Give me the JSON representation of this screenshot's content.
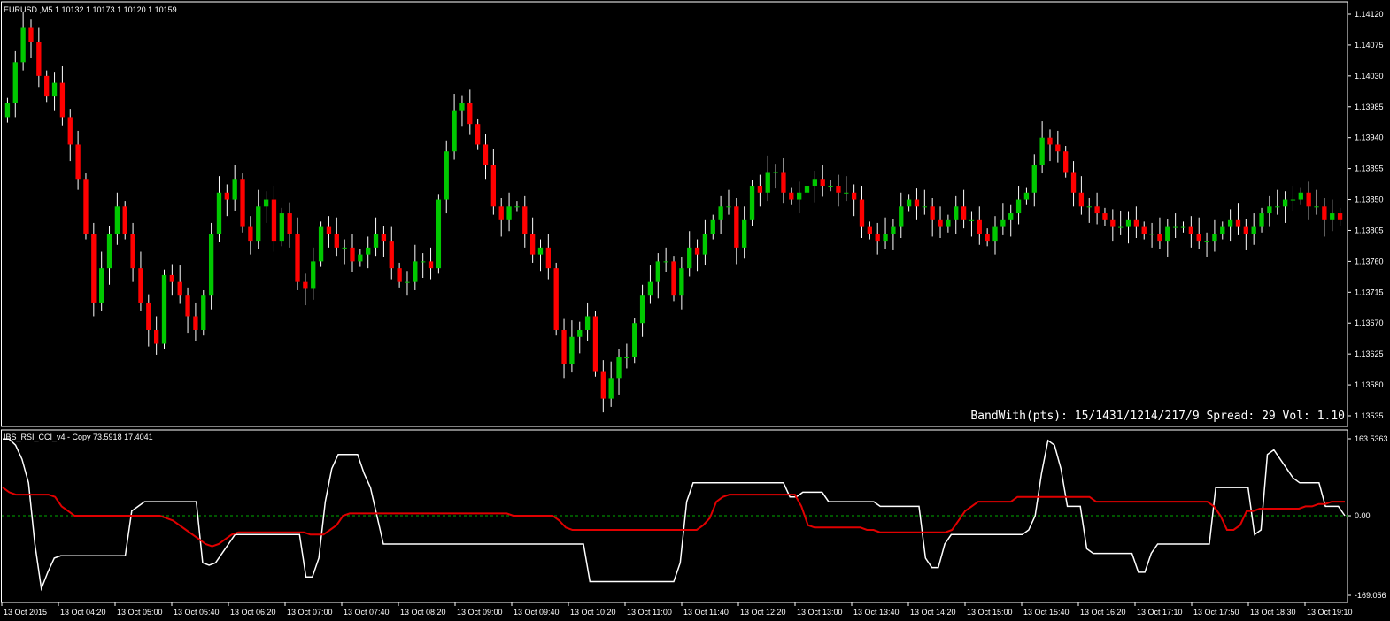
{
  "main_chart": {
    "header": "EURUSD.,M5  1.10132 1.10173 1.10120 1.10159",
    "status": "BandWith(pts): 15/1431/1214/217/9 Spread: 29 Vol: 1.10",
    "price_ticks": [
      "1.14120",
      "1.14075",
      "1.14030",
      "1.13985",
      "1.13940",
      "1.13895",
      "1.13850",
      "1.13805",
      "1.13760",
      "1.13715",
      "1.13670",
      "1.13625",
      "1.13580",
      "1.13535"
    ],
    "candle_colors": {
      "up": "#00c800",
      "down": "#ff0000",
      "wick": "#ffffff"
    }
  },
  "indicator": {
    "header": "IBS_RSI_CCI_v4 - Copy 73.5918 17.4041",
    "ticks": [
      "163.5363",
      "0.00",
      "-169.056"
    ],
    "line_colors": {
      "fast": "#ffffff",
      "slow": "#e00000",
      "zero": "#00aa00"
    }
  },
  "time_axis": [
    "13 Oct 2015",
    "13 Oct 04:20",
    "13 Oct 05:00",
    "13 Oct 05:40",
    "13 Oct 06:20",
    "13 Oct 07:00",
    "13 Oct 07:40",
    "13 Oct 08:20",
    "13 Oct 09:00",
    "13 Oct 09:40",
    "13 Oct 10:20",
    "13 Oct 11:00",
    "13 Oct 11:40",
    "13 Oct 12:20",
    "13 Oct 13:00",
    "13 Oct 13:40",
    "13 Oct 14:20",
    "13 Oct 15:00",
    "13 Oct 15:40",
    "13 Oct 16:20",
    "13 Oct 17:10",
    "13 Oct 17:50",
    "13 Oct 18:30",
    "13 Oct 19:10"
  ],
  "chart_data": [
    {
      "type": "candlestick",
      "title": "EURUSD.,M5",
      "ylim": [
        1.13535,
        1.1412
      ],
      "close": [
        1.1399,
        1.1405,
        1.141,
        1.1408,
        1.1403,
        1.14,
        1.1402,
        1.1397,
        1.1393,
        1.1388,
        1.138,
        1.137,
        1.1375,
        1.138,
        1.1384,
        1.138,
        1.1375,
        1.137,
        1.1366,
        1.1364,
        1.1374,
        1.1373,
        1.1371,
        1.1368,
        1.1366,
        1.1371,
        1.138,
        1.1386,
        1.1385,
        1.1388,
        1.1381,
        1.1379,
        1.1384,
        1.1385,
        1.1379,
        1.1383,
        1.138,
        1.1373,
        1.1372,
        1.1376,
        1.1381,
        1.138,
        1.1378,
        1.1378,
        1.1376,
        1.1377,
        1.1378,
        1.138,
        1.1379,
        1.1375,
        1.1373,
        1.1373,
        1.1376,
        1.1376,
        1.1375,
        1.1385,
        1.1392,
        1.1398,
        1.1399,
        1.1396,
        1.1393,
        1.139,
        1.1384,
        1.1382,
        1.1384,
        1.1384,
        1.138,
        1.1377,
        1.1378,
        1.1375,
        1.1366,
        1.1361,
        1.1365,
        1.1366,
        1.1368,
        1.136,
        1.1356,
        1.1359,
        1.1362,
        1.1362,
        1.1367,
        1.1371,
        1.1373,
        1.1376,
        1.1376,
        1.1371,
        1.1375,
        1.1378,
        1.1377,
        1.138,
        1.1382,
        1.1384,
        1.1384,
        1.1378,
        1.1382,
        1.1387,
        1.1386,
        1.1389,
        1.1389,
        1.1386,
        1.1385,
        1.1386,
        1.1387,
        1.1388,
        1.1387,
        1.1387,
        1.1386,
        1.1386,
        1.1385,
        1.1381,
        1.138,
        1.1379,
        1.138,
        1.1381,
        1.1384,
        1.1385,
        1.1384,
        1.1384,
        1.1382,
        1.1381,
        1.1382,
        1.1384,
        1.1382,
        1.1382,
        1.138,
        1.1379,
        1.1381,
        1.1382,
        1.1383,
        1.1385,
        1.1386,
        1.139,
        1.1394,
        1.1393,
        1.1392,
        1.1389,
        1.1386,
        1.1384,
        1.1384,
        1.1383,
        1.1382,
        1.1381,
        1.1381,
        1.1382,
        1.1381,
        1.138,
        1.138,
        1.1379,
        1.1381,
        1.1381,
        1.1381,
        1.138,
        1.1379,
        1.1379,
        1.138,
        1.1381,
        1.1382,
        1.1381,
        1.138,
        1.1381,
        1.1383,
        1.1384,
        1.1384,
        1.1385,
        1.1385,
        1.1386,
        1.1384,
        1.1384,
        1.1382,
        1.1383,
        1.1382
      ],
      "ohlc_note": "OHLC series drawn by script from close values"
    },
    {
      "type": "line",
      "title": "IBS_RSI_CCI_v4 - Copy",
      "ylim": [
        -169.056,
        163.5363
      ],
      "series": [
        {
          "name": "IBS_RSI_CCI_v4 - Copy 73.5918",
          "values": [
            163,
            163,
            150,
            120,
            70,
            -60,
            -155,
            -120,
            -90,
            -85,
            -85,
            -85,
            -85,
            -85,
            -85,
            -85,
            -85,
            -85,
            -85,
            -85,
            10,
            20,
            30,
            30,
            30,
            30,
            30,
            30,
            30,
            30,
            30,
            -100,
            -105,
            -100,
            -80,
            -60,
            -40,
            -40,
            -40,
            -40,
            -40,
            -40,
            -40,
            -40,
            -40,
            -40,
            -40,
            -130,
            -130,
            -90,
            30,
            100,
            130,
            130,
            130,
            130,
            90,
            60,
            0,
            -60,
            -60,
            -60,
            -60,
            -60,
            -60,
            -60,
            -60,
            -60,
            -60,
            -60,
            -60,
            -60,
            -60,
            -60,
            -60,
            -60,
            -60,
            -60,
            -60,
            -60,
            -60,
            -60,
            -60,
            -60,
            -60,
            -60,
            -60,
            -60,
            -60,
            -60,
            -60,
            -140,
            -140,
            -140,
            -140,
            -140,
            -140,
            -140,
            -140,
            -140,
            -140,
            -140,
            -140,
            -140,
            -140,
            -100,
            30,
            70,
            70,
            70,
            70,
            70,
            70,
            70,
            70,
            70,
            70,
            70,
            70,
            70,
            70,
            70,
            40,
            40,
            50,
            50,
            50,
            50,
            30,
            30,
            30,
            30,
            30,
            30,
            30,
            30,
            20,
            20,
            20,
            20,
            20,
            20,
            20,
            -90,
            -110,
            -110,
            -60,
            -40,
            -40,
            -40,
            -40,
            -40,
            -40,
            -40,
            -40,
            -40,
            -40,
            -40,
            -40,
            -30,
            0,
            90,
            160,
            150,
            100,
            20,
            20,
            20,
            -70,
            -80,
            -80,
            -80,
            -80,
            -80,
            -80,
            -80,
            -120,
            -120,
            -80,
            -60,
            -60,
            -60,
            -60,
            -60,
            -60,
            -60,
            -60,
            -60,
            60,
            60,
            60,
            60,
            60,
            60,
            -40,
            -30,
            130,
            140,
            120,
            100,
            80,
            70,
            70,
            70,
            70,
            20,
            20,
            20,
            0
          ]
        },
        {
          "name": "IBS_RSI_CCI_v4 - Copy 17.4041",
          "values": [
            60,
            50,
            45,
            45,
            45,
            45,
            45,
            45,
            40,
            20,
            10,
            0,
            0,
            0,
            0,
            0,
            0,
            0,
            0,
            0,
            0,
            0,
            0,
            0,
            0,
            -5,
            -10,
            -20,
            -30,
            -40,
            -50,
            -60,
            -65,
            -60,
            -50,
            -40,
            -35,
            -35,
            -35,
            -35,
            -35,
            -35,
            -35,
            -35,
            -35,
            -35,
            -35,
            -40,
            -40,
            -40,
            -30,
            -20,
            0,
            5,
            5,
            5,
            5,
            5,
            5,
            5,
            5,
            5,
            5,
            5,
            5,
            5,
            5,
            5,
            5,
            5,
            5,
            5,
            5,
            5,
            5,
            5,
            5,
            5,
            0,
            0,
            0,
            0,
            0,
            0,
            0,
            -10,
            -25,
            -30,
            -30,
            -30,
            -30,
            -30,
            -30,
            -30,
            -30,
            -30,
            -30,
            -30,
            -30,
            -30,
            -30,
            -30,
            -30,
            -30,
            -30,
            -30,
            -30,
            -20,
            -5,
            30,
            40,
            45,
            45,
            45,
            45,
            45,
            45,
            45,
            45,
            45,
            45,
            45,
            20,
            -20,
            -25,
            -25,
            -25,
            -25,
            -25,
            -25,
            -25,
            -25,
            -30,
            -30,
            -35,
            -35,
            -35,
            -35,
            -35,
            -35,
            -35,
            -35,
            -35,
            -35,
            -35,
            -30,
            -10,
            10,
            20,
            30,
            30,
            30,
            30,
            30,
            30,
            40,
            40,
            40,
            40,
            40,
            40,
            40,
            40,
            40,
            40,
            40,
            40,
            30,
            30,
            30,
            30,
            30,
            30,
            30,
            30,
            30,
            30,
            30,
            30,
            30,
            30,
            30,
            30,
            30,
            30,
            20,
            0,
            -30,
            -30,
            -20,
            10,
            10,
            15,
            15,
            15,
            15,
            15,
            15,
            15,
            20,
            20,
            25,
            25,
            30,
            30,
            30
          ]
        }
      ]
    }
  ]
}
